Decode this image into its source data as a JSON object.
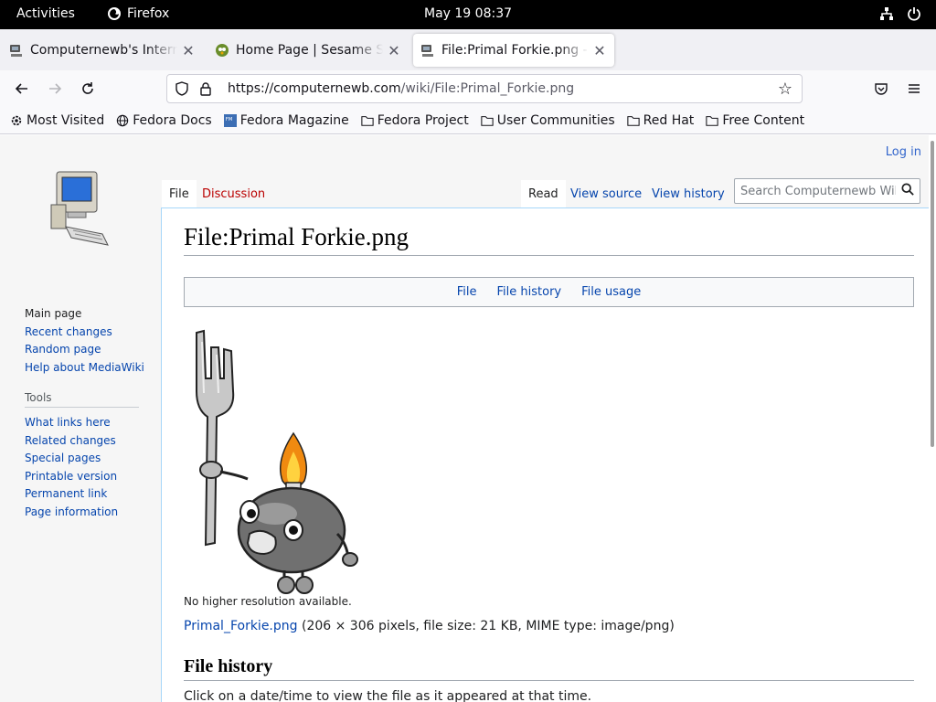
{
  "system": {
    "activities": "Activities",
    "app_name": "Firefox",
    "clock": "May 19  08:37"
  },
  "tabs": [
    {
      "title": "Computernewb's Internet",
      "active": false
    },
    {
      "title": "Home Page | Sesame Street",
      "active": false
    },
    {
      "title": "File:Primal Forkie.png - Computernewb",
      "active": true
    }
  ],
  "navbar": {
    "url_host": "https://computernewb.com",
    "url_path": "/wiki/File:Primal_Forkie.png"
  },
  "bookmarks": [
    {
      "label": "Most Visited",
      "icon": "gear-icon"
    },
    {
      "label": "Fedora Docs",
      "icon": "globe-icon"
    },
    {
      "label": "Fedora Magazine",
      "icon": "fm-icon"
    },
    {
      "label": "Fedora Project",
      "icon": "folder-icon"
    },
    {
      "label": "User Communities",
      "icon": "folder-icon"
    },
    {
      "label": "Red Hat",
      "icon": "folder-icon"
    },
    {
      "label": "Free Content",
      "icon": "folder-icon"
    }
  ],
  "wiki": {
    "login": "Log in",
    "tabs": {
      "file": "File",
      "discussion": "Discussion",
      "read": "Read",
      "view_source": "View source",
      "view_history": "View history"
    },
    "search_placeholder": "Search Computernewb Wiki",
    "nav": [
      "Main page",
      "Recent changes",
      "Random page",
      "Help about MediaWiki"
    ],
    "tools_heading": "Tools",
    "tools": [
      "What links here",
      "Related changes",
      "Special pages",
      "Printable version",
      "Permanent link",
      "Page information"
    ],
    "title": "File:Primal Forkie.png",
    "filetoc": [
      "File",
      "File history",
      "File usage"
    ],
    "no_higher_res": "No higher resolution available.",
    "file_link": "Primal_Forkie.png",
    "file_meta": " (206 × 306 pixels, file size: 21 KB, MIME type: image/png)",
    "history_heading": "File history",
    "history_note": "Click on a date/time to view the file as it appeared at that time."
  }
}
